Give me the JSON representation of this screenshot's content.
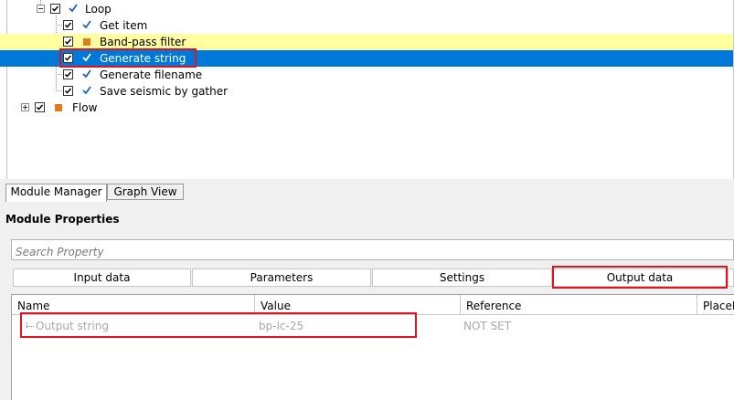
{
  "tree": {
    "items": [
      {
        "label": "Loop",
        "checked": true,
        "status": "check"
      },
      {
        "label": "Get item",
        "checked": true,
        "status": "check"
      },
      {
        "label": "Band-pass filter",
        "checked": true,
        "status": "square"
      },
      {
        "label": "Generate string",
        "checked": true,
        "status": "check",
        "selected": true
      },
      {
        "label": "Generate filename",
        "checked": true,
        "status": "check"
      },
      {
        "label": "Save seismic by gather",
        "checked": true,
        "status": "check"
      },
      {
        "label": "Flow",
        "checked": true,
        "status": "square"
      }
    ]
  },
  "view_tabs": [
    "Module Manager",
    "Graph View"
  ],
  "module_properties": {
    "title": "Module Properties",
    "search_placeholder": "Search Property",
    "tabs": [
      "Input data",
      "Parameters",
      "Settings",
      "Output data"
    ],
    "active_tab": "Output data",
    "grid": {
      "headers": [
        "Name",
        "Value",
        "Reference",
        "PlaceH"
      ],
      "rows": [
        {
          "name": "Output string",
          "value": "bp-lc-25",
          "reference": "NOT SET"
        }
      ]
    }
  },
  "colors": {
    "selection": "#0078d7",
    "highlight": "#ffffa0",
    "check": "#1f5fbf",
    "square_icon": "#e07a1f",
    "annotation": "#e0141e"
  }
}
